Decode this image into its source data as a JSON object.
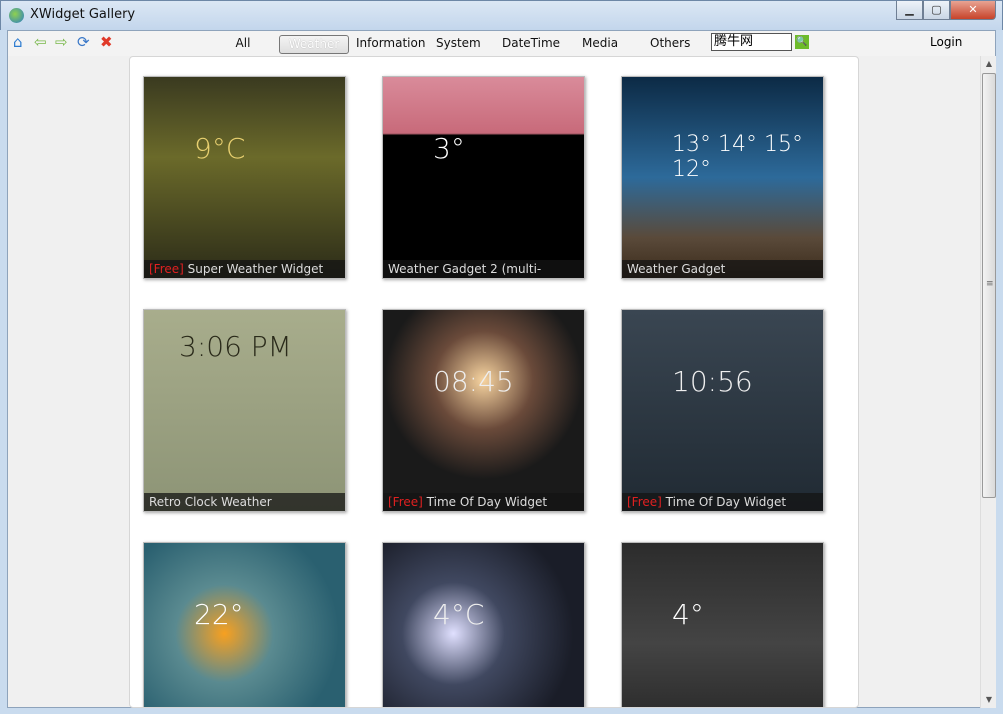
{
  "window": {
    "title": "XWidget Gallery",
    "minimize": "▁",
    "maximize": "▢",
    "close": "✕"
  },
  "toolbar": {
    "icons": {
      "home": "⌂",
      "back": "⇦",
      "forward": "⇨",
      "refresh": "⟳",
      "stop": "✖"
    },
    "tabs": [
      {
        "label": "All"
      },
      {
        "label": "Weather"
      },
      {
        "label": "Information"
      },
      {
        "label": "System"
      },
      {
        "label": "DateTime"
      },
      {
        "label": "Media"
      },
      {
        "label": "Others"
      }
    ],
    "search_value": "腾牛网",
    "search_icon": "🔍",
    "login": "Login"
  },
  "cards": [
    {
      "free": "[Free]",
      "title": " Super Weather Widget",
      "text": "9°C"
    },
    {
      "free": "",
      "title": "Weather Gadget 2 (multi-",
      "text": "3°"
    },
    {
      "free": "",
      "title": "Weather Gadget",
      "text": "13°  14°  15°  12°"
    },
    {
      "free": "",
      "title": "Retro Clock Weather",
      "text": "3:06 PM"
    },
    {
      "free": "[Free]",
      "title": " Time Of Day Widget",
      "text": "08:45"
    },
    {
      "free": "[Free]",
      "title": " Time Of Day Widget",
      "text": "10:56"
    },
    {
      "free": "",
      "title": "",
      "text": "22°"
    },
    {
      "free": "",
      "title": "",
      "text": "4°C"
    },
    {
      "free": "",
      "title": "",
      "text": "4°"
    }
  ]
}
